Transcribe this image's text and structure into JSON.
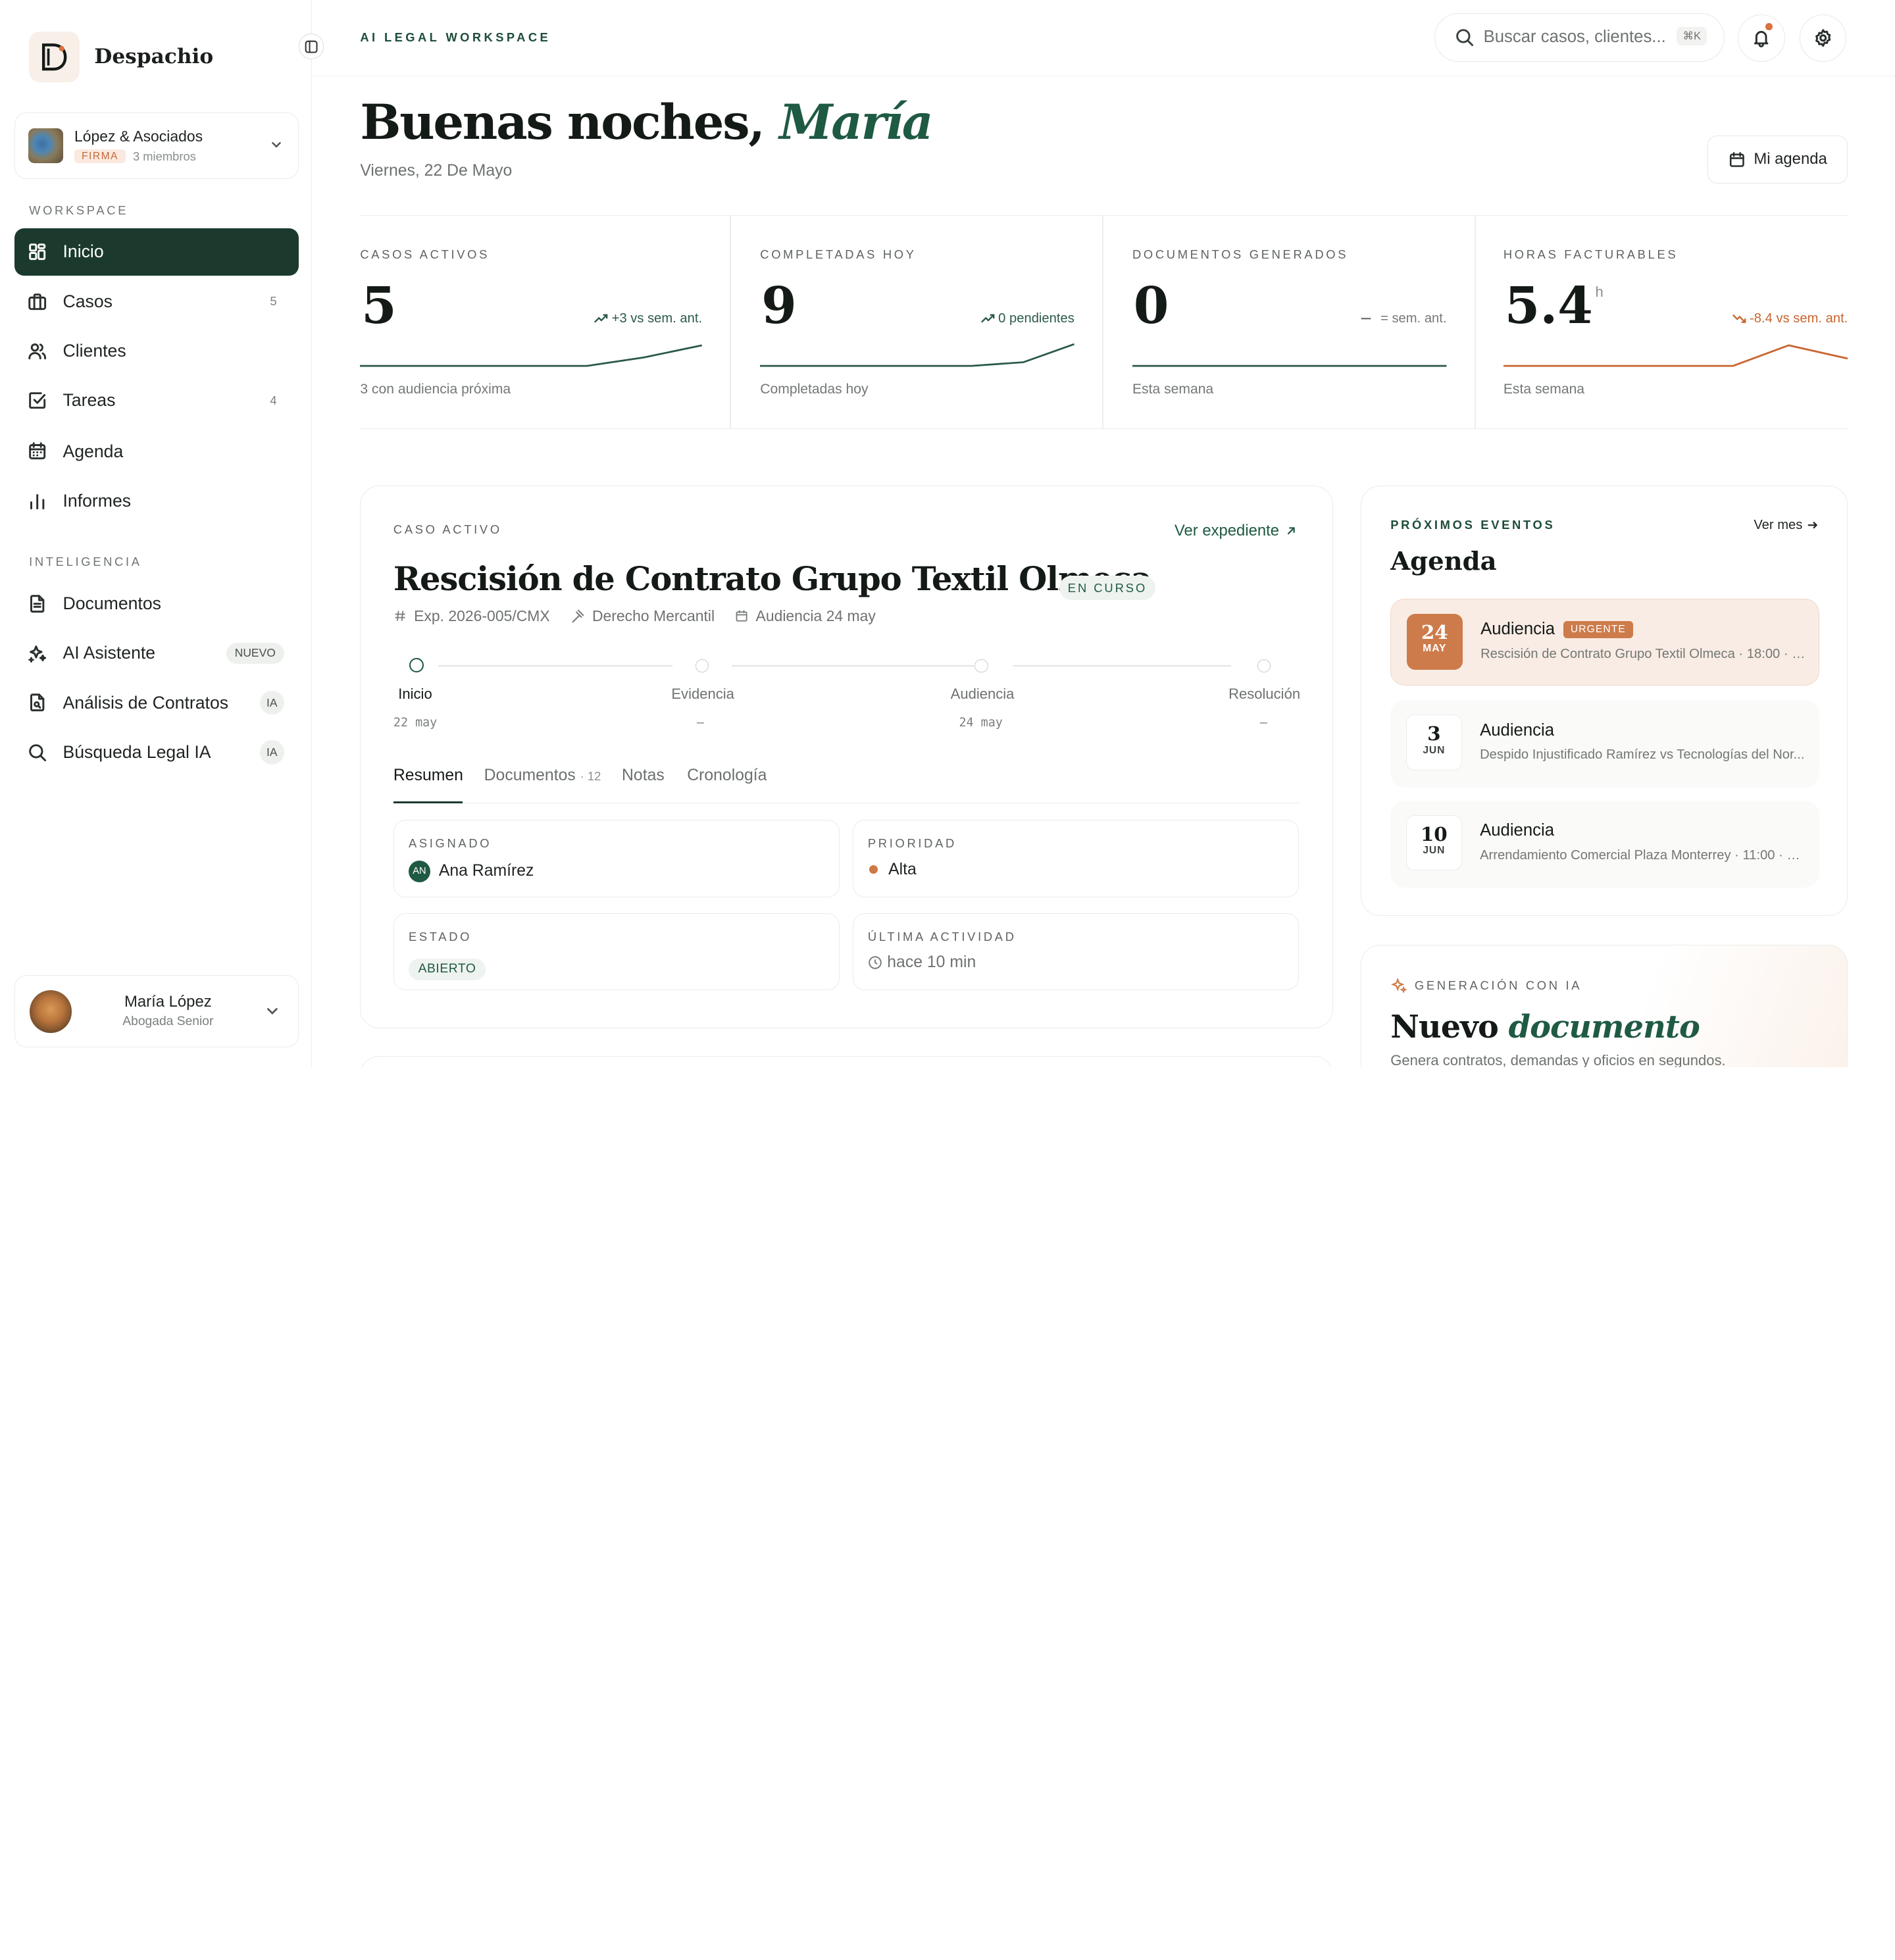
{
  "brand": {
    "name": "Despachio"
  },
  "firm": {
    "name": "López & Asociados",
    "badge": "FIRMA",
    "members": "3 miembros"
  },
  "sidebar": {
    "section_workspace": "WORKSPACE",
    "section_intel": "INTELIGENCIA",
    "items": [
      {
        "label": "Inicio",
        "icon": "grid-icon"
      },
      {
        "label": "Casos",
        "count": "5",
        "icon": "briefcase-icon"
      },
      {
        "label": "Clientes",
        "icon": "users-icon"
      },
      {
        "label": "Tareas",
        "count": "4",
        "icon": "checkbox-icon"
      },
      {
        "label": "Agenda",
        "icon": "calendar-icon"
      },
      {
        "label": "Informes",
        "icon": "bar-chart-icon"
      },
      {
        "label": "Documentos",
        "icon": "document-icon"
      },
      {
        "label": "AI Asistente",
        "pill": "NUEVO",
        "icon": "sparkles-icon"
      },
      {
        "label": "Análisis de Contratos",
        "pill": "IA",
        "icon": "file-search-icon"
      },
      {
        "label": "Búsqueda Legal IA",
        "pill": "IA",
        "icon": "search-icon"
      }
    ]
  },
  "user": {
    "name": "María López",
    "role": "Abogada Senior"
  },
  "topbar": {
    "eyebrow": "AI LEGAL WORKSPACE",
    "search_placeholder": "Buscar casos, clientes...",
    "shortcut": "⌘K"
  },
  "greeting": {
    "prefix": "Buenas noches,",
    "name": "María",
    "date": "Viernes, 22 De Mayo",
    "agenda_button": "Mi agenda"
  },
  "stats": [
    {
      "label": "CASOS ACTIVOS",
      "value": "5",
      "unit": "",
      "delta": "+3 vs sem. ant.",
      "trend": "up",
      "foot": "3 con audiencia próxima"
    },
    {
      "label": "COMPLETADAS HOY",
      "value": "9",
      "unit": "",
      "delta": "0 pendientes",
      "trend": "up",
      "foot": "Completadas hoy"
    },
    {
      "label": "DOCUMENTOS GENERADOS",
      "value": "0",
      "unit": "",
      "delta": "= sem. ant.",
      "trend": "flat",
      "foot": "Esta semana"
    },
    {
      "label": "HORAS FACTURABLES",
      "value": "5.4",
      "unit": "h",
      "delta": "-8.4 vs sem. ant.",
      "trend": "down",
      "foot": "Esta semana"
    }
  ],
  "colors": {
    "primary": "#1b3a2d",
    "accent": "#1f5a43",
    "warm": "#cd7b4b"
  },
  "case": {
    "eyebrow": "CASO ACTIVO",
    "link": "Ver expediente",
    "title": "Rescisión de Contrato Grupo Textil Olmeca",
    "status": "EN CURSO",
    "exp": "Exp. 2026-005/CMX",
    "area": "Derecho Mercantil",
    "hearing": "Audiencia 24 may",
    "timeline": [
      {
        "label": "Inicio",
        "date": "22 may",
        "done": true
      },
      {
        "label": "Evidencia",
        "date": "—",
        "done": false
      },
      {
        "label": "Audiencia",
        "date": "24 may",
        "done": false
      },
      {
        "label": "Resolución",
        "date": "—",
        "done": false
      }
    ],
    "tabs": [
      {
        "label": "Resumen"
      },
      {
        "label": "Documentos",
        "count": "· 12"
      },
      {
        "label": "Notas"
      },
      {
        "label": "Cronología"
      }
    ],
    "fields": {
      "assigned_label": "ASIGNADO",
      "assigned_initials": "AN",
      "assigned_value": "Ana Ramírez",
      "priority_label": "PRIORIDAD",
      "priority_value": "Alta",
      "state_label": "ESTADO",
      "state_value": "ABIERTO",
      "activity_label": "ÚLTIMA ACTIVIDAD",
      "activity_value": "hace 10 min"
    }
  },
  "agenda": {
    "eyebrow": "PRÓXIMOS EVENTOS",
    "link": "Ver mes",
    "title": "Agenda",
    "events": [
      {
        "day": "24",
        "month": "MAY",
        "title": "Audiencia",
        "tag": "URGENTE",
        "subtitle": "Rescisión de Contrato Grupo Textil Olmeca · 18:00 · J..."
      },
      {
        "day": "3",
        "month": "JUN",
        "title": "Audiencia",
        "subtitle": "Despido Injustificado Ramírez vs Tecnologías del Nor..."
      },
      {
        "day": "10",
        "month": "JUN",
        "title": "Audiencia",
        "subtitle": "Arrendamiento Comercial Plaza Monterrey · 11:00 · Ju..."
      }
    ]
  },
  "gen": {
    "eyebrow": "GENERACIÓN CON IA",
    "title_a": "Nuevo",
    "title_b": "documento",
    "desc": "Genera contratos, demandas y oficios en segundos."
  }
}
